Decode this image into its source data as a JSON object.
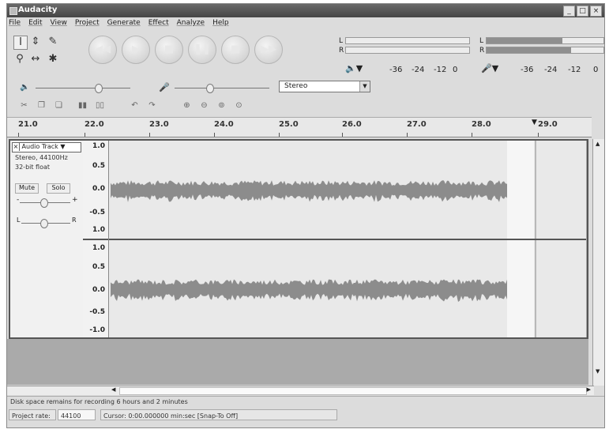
{
  "window": {
    "title": "Audacity",
    "buttons": [
      "_",
      "×"
    ]
  },
  "menu": [
    "File",
    "Edit",
    "View",
    "Project",
    "Generate",
    "Effect",
    "Analyze",
    "Help"
  ],
  "meters": {
    "play_label_L": "L",
    "play_label_R": "R",
    "rec_label_L": "L",
    "rec_label_R": "R",
    "play_ticks": [
      "-36",
      "-24",
      "-12",
      "0"
    ],
    "rec_ticks": [
      "-36",
      "-24",
      "-12",
      "0"
    ],
    "playback_levels": {
      "L": 0,
      "R": 0
    },
    "record_levels": {
      "L": 0.65,
      "R": 0.72
    }
  },
  "mixer": {
    "channel_select": "Stereo"
  },
  "ruler": {
    "labels": [
      "21.0",
      "22.0",
      "23.0",
      "24.0",
      "25.0",
      "26.0",
      "27.0",
      "28.0",
      "29.0"
    ]
  },
  "track": {
    "name": "Audio Track",
    "info_line1": "Stereo, 44100Hz",
    "info_line2": "32-bit float",
    "mute_label": "Mute",
    "solo_label": "Solo",
    "gain_minus": "-",
    "gain_plus": "+",
    "pan_left": "L",
    "pan_right": "R",
    "channels": [
      {
        "scale": [
          "1.0",
          "0.5",
          "0.0",
          "-0.5",
          "1.0"
        ]
      },
      {
        "scale": [
          "1.0",
          "0.5",
          "0.0",
          "-0.5",
          "-1.0"
        ]
      }
    ]
  },
  "status": {
    "disk_space": "Disk space remains for recording 6 hours and 2 minutes",
    "project_rate_label": "Project rate:",
    "project_rate_value": "44100",
    "cursor_text": "Cursor: 0:00.000000 min:sec   [Snap-To Off]"
  },
  "colors": {
    "waveform": "#8c8c8c",
    "title_bar": "#4a4a4a",
    "track_bg": "#e9e9e9"
  },
  "icons": {
    "tools": [
      "selection-icon",
      "envelope-icon",
      "draw-icon",
      "zoom-icon",
      "timeshift-icon",
      "multi-tool-icon"
    ],
    "transport": [
      "skip-start-icon",
      "play-icon",
      "loop-play-icon",
      "pause-icon",
      "stop-icon",
      "skip-end-icon"
    ]
  }
}
